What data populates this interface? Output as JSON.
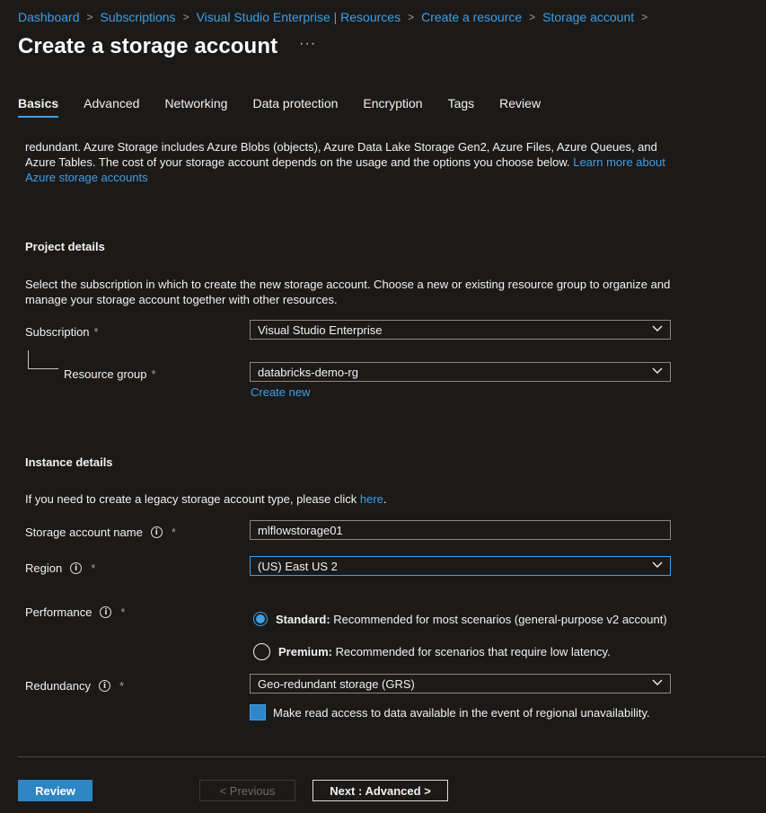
{
  "breadcrumb": {
    "items": [
      "Dashboard",
      "Subscriptions",
      "Visual Studio Enterprise | Resources",
      "Create a resource",
      "Storage account"
    ],
    "separator": ">"
  },
  "header": {
    "title": "Create a storage account",
    "more_label": "···"
  },
  "tabs": [
    "Basics",
    "Advanced",
    "Networking",
    "Data protection",
    "Encryption",
    "Tags",
    "Review"
  ],
  "intro": {
    "text": "redundant. Azure Storage includes Azure Blobs (objects), Azure Data Lake Storage Gen2, Azure Files, Azure Queues, and Azure Tables. The cost of your storage account depends on the usage and the options you choose below. ",
    "link": "Learn more about Azure storage accounts"
  },
  "project": {
    "title": "Project details",
    "description": "Select the subscription in which to create the new storage account. Choose a new or existing resource group to organize and manage your storage account together with other resources.",
    "subscription_label": "Subscription",
    "subscription_value": "Visual Studio Enterprise",
    "resource_group_label": "Resource group",
    "resource_group_value": "databricks-demo-rg",
    "create_new": "Create new"
  },
  "instance": {
    "title": "Instance details",
    "legacy_text": "If you need to create a legacy storage account type, please click ",
    "legacy_link": "here",
    "legacy_end": ".",
    "name_label": "Storage account name",
    "name_value": "mlflowstorage01",
    "region_label": "Region",
    "region_value": "(US) East US 2",
    "performance_label": "Performance",
    "standard_bold": "Standard:",
    "standard_text": " Recommended for most scenarios (general-purpose v2 account)",
    "premium_bold": "Premium:",
    "premium_text": " Recommended for scenarios that require low latency.",
    "redundancy_label": "Redundancy",
    "redundancy_value": "Geo-redundant storage (GRS)",
    "read_access_label": "Make read access to data available in the event of regional unavailability."
  },
  "required_marker": "*",
  "info_glyph": "i",
  "footer": {
    "review": "Review",
    "previous": "< Previous",
    "next": "Next : Advanced >"
  },
  "colors": {
    "accent": "#3ea0e8",
    "background": "#1b1a19",
    "primary_button": "#2d85c4"
  }
}
